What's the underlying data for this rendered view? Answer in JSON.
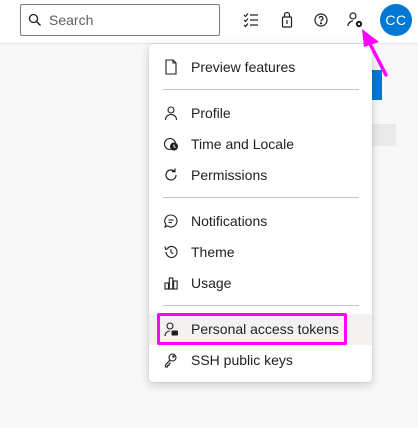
{
  "search": {
    "placeholder": "Search"
  },
  "topbar": {
    "icons": [
      "work-items-icon",
      "marketplace-bag-icon",
      "help-icon",
      "user-settings-icon"
    ],
    "avatar_initials": "CC",
    "avatar_color": "#0078d4"
  },
  "menu": {
    "items": [
      {
        "label": "Preview features",
        "icon": "document-icon"
      },
      {
        "label": "Profile",
        "icon": "profile-icon"
      },
      {
        "label": "Time and Locale",
        "icon": "globe-clock-icon"
      },
      {
        "label": "Permissions",
        "icon": "refresh-icon"
      },
      {
        "label": "Notifications",
        "icon": "chat-bubble-icon"
      },
      {
        "label": "Theme",
        "icon": "history-icon"
      },
      {
        "label": "Usage",
        "icon": "bar-chart-icon"
      },
      {
        "label": "Personal access tokens",
        "icon": "token-icon"
      },
      {
        "label": "SSH public keys",
        "icon": "key-icon"
      }
    ]
  },
  "annotation": {
    "highlight_color": "#ff00ff",
    "target": "Personal access tokens"
  }
}
